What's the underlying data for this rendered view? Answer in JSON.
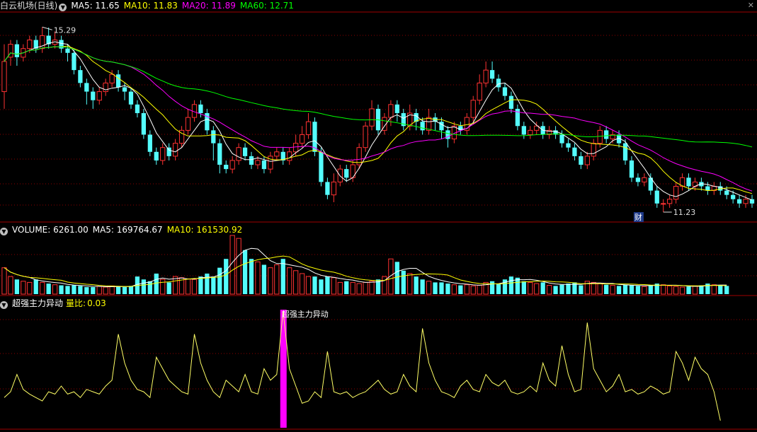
{
  "main_panel": {
    "stock_name": "白云机场(日线)",
    "ma": [
      {
        "label": "MA5: 11.65",
        "color": "#ffffff"
      },
      {
        "label": "MA10: 11.83",
        "color": "#ffff00"
      },
      {
        "label": "MA20: 11.89",
        "color": "#ff00ff"
      },
      {
        "label": "MA60: 12.71",
        "color": "#00ff00"
      }
    ],
    "high_label": "15.29",
    "low_label": "11.23",
    "badge": "财"
  },
  "volume_panel": {
    "title": "VOLUME: 6261.00",
    "ma5": "MA5: 169764.67",
    "ma10": "MA10: 161530.92"
  },
  "indicator_panel": {
    "title": "超强主力异动",
    "ratio_label": "量比:",
    "ratio_value": "0.03",
    "signal_label": "超强主力异动"
  },
  "colors": {
    "up": "#ff3232",
    "down": "#54fcfc",
    "ma5": "#ffffff",
    "ma10": "#ffff00",
    "ma20": "#ff00ff",
    "ma60": "#00ff00",
    "grid": "#8b0000",
    "indicator": "#ffff66",
    "signal": "#ff00ff"
  },
  "chart_data": {
    "type": "candlestick",
    "price_ylim": [
      11.0,
      15.6
    ],
    "high": 15.29,
    "low": 11.23,
    "candles": [
      {
        "o": 13.8,
        "c": 14.5,
        "h": 14.9,
        "l": 13.4
      },
      {
        "o": 14.6,
        "c": 14.9,
        "h": 15.0,
        "l": 14.4
      },
      {
        "o": 14.9,
        "c": 14.6,
        "h": 15.0,
        "l": 14.4
      },
      {
        "o": 14.6,
        "c": 14.8,
        "h": 14.9,
        "l": 14.5
      },
      {
        "o": 14.8,
        "c": 15.0,
        "h": 15.1,
        "l": 14.7
      },
      {
        "o": 15.0,
        "c": 14.8,
        "h": 15.1,
        "l": 14.7
      },
      {
        "o": 14.8,
        "c": 15.1,
        "h": 15.3,
        "l": 14.7
      },
      {
        "o": 15.1,
        "c": 14.9,
        "h": 15.29,
        "l": 14.8
      },
      {
        "o": 14.9,
        "c": 15.0,
        "h": 15.2,
        "l": 14.8
      },
      {
        "o": 15.0,
        "c": 14.8,
        "h": 15.1,
        "l": 14.7
      },
      {
        "o": 14.8,
        "c": 14.7,
        "h": 14.9,
        "l": 14.5
      },
      {
        "o": 14.7,
        "c": 14.3,
        "h": 14.8,
        "l": 14.2
      },
      {
        "o": 14.3,
        "c": 14.0,
        "h": 14.4,
        "l": 13.9
      },
      {
        "o": 14.0,
        "c": 13.8,
        "h": 14.1,
        "l": 13.5
      },
      {
        "o": 13.8,
        "c": 13.6,
        "h": 13.9,
        "l": 13.4
      },
      {
        "o": 13.6,
        "c": 13.8,
        "h": 13.9,
        "l": 13.5
      },
      {
        "o": 13.8,
        "c": 14.0,
        "h": 14.1,
        "l": 13.7
      },
      {
        "o": 14.0,
        "c": 14.2,
        "h": 14.3,
        "l": 13.9
      },
      {
        "o": 14.2,
        "c": 13.9,
        "h": 14.3,
        "l": 13.8
      },
      {
        "o": 13.9,
        "c": 13.8,
        "h": 14.0,
        "l": 13.6
      },
      {
        "o": 13.8,
        "c": 13.5,
        "h": 13.9,
        "l": 13.4
      },
      {
        "o": 13.5,
        "c": 13.3,
        "h": 13.6,
        "l": 13.2
      },
      {
        "o": 13.3,
        "c": 12.8,
        "h": 13.4,
        "l": 12.7
      },
      {
        "o": 12.8,
        "c": 12.4,
        "h": 12.9,
        "l": 12.3
      },
      {
        "o": 12.4,
        "c": 12.2,
        "h": 12.5,
        "l": 12.1
      },
      {
        "o": 12.2,
        "c": 12.5,
        "h": 12.6,
        "l": 12.1
      },
      {
        "o": 12.5,
        "c": 12.3,
        "h": 12.6,
        "l": 12.2
      },
      {
        "o": 12.3,
        "c": 12.6,
        "h": 12.7,
        "l": 12.2
      },
      {
        "o": 12.6,
        "c": 12.9,
        "h": 13.0,
        "l": 12.5
      },
      {
        "o": 12.9,
        "c": 13.2,
        "h": 13.4,
        "l": 12.8
      },
      {
        "o": 13.2,
        "c": 13.5,
        "h": 13.6,
        "l": 13.1
      },
      {
        "o": 13.5,
        "c": 13.3,
        "h": 13.6,
        "l": 13.2
      },
      {
        "o": 13.3,
        "c": 12.9,
        "h": 13.4,
        "l": 12.8
      },
      {
        "o": 12.9,
        "c": 12.6,
        "h": 13.0,
        "l": 12.2
      },
      {
        "o": 12.6,
        "c": 12.1,
        "h": 12.7,
        "l": 11.9
      },
      {
        "o": 12.1,
        "c": 12.0,
        "h": 12.2,
        "l": 11.9
      },
      {
        "o": 12.0,
        "c": 12.2,
        "h": 12.3,
        "l": 11.9
      },
      {
        "o": 12.2,
        "c": 12.5,
        "h": 12.6,
        "l": 12.1
      },
      {
        "o": 12.5,
        "c": 12.3,
        "h": 12.6,
        "l": 12.2
      },
      {
        "o": 12.3,
        "c": 12.1,
        "h": 12.4,
        "l": 12.0
      },
      {
        "o": 12.1,
        "c": 12.2,
        "h": 12.3,
        "l": 12.0
      },
      {
        "o": 12.2,
        "c": 12.0,
        "h": 12.3,
        "l": 11.9
      },
      {
        "o": 12.0,
        "c": 12.3,
        "h": 12.4,
        "l": 11.9
      },
      {
        "o": 12.3,
        "c": 12.4,
        "h": 12.5,
        "l": 12.2
      },
      {
        "o": 12.4,
        "c": 12.2,
        "h": 12.5,
        "l": 12.1
      },
      {
        "o": 12.2,
        "c": 12.4,
        "h": 12.5,
        "l": 12.1
      },
      {
        "o": 12.4,
        "c": 12.6,
        "h": 12.8,
        "l": 12.3
      },
      {
        "o": 12.6,
        "c": 12.8,
        "h": 13.0,
        "l": 12.5
      },
      {
        "o": 12.8,
        "c": 13.1,
        "h": 13.3,
        "l": 12.7
      },
      {
        "o": 13.1,
        "c": 12.4,
        "h": 13.2,
        "l": 12.3
      },
      {
        "o": 12.4,
        "c": 11.7,
        "h": 12.5,
        "l": 11.6
      },
      {
        "o": 11.7,
        "c": 11.4,
        "h": 11.8,
        "l": 11.3
      },
      {
        "o": 11.4,
        "c": 11.7,
        "h": 11.9,
        "l": 11.23
      },
      {
        "o": 11.7,
        "c": 12.0,
        "h": 12.1,
        "l": 11.6
      },
      {
        "o": 12.0,
        "c": 11.8,
        "h": 12.1,
        "l": 11.7
      },
      {
        "o": 11.8,
        "c": 12.1,
        "h": 12.2,
        "l": 11.7
      },
      {
        "o": 12.1,
        "c": 12.5,
        "h": 12.6,
        "l": 12.0
      },
      {
        "o": 12.5,
        "c": 13.0,
        "h": 13.1,
        "l": 12.4
      },
      {
        "o": 13.0,
        "c": 13.4,
        "h": 13.6,
        "l": 12.9
      },
      {
        "o": 13.4,
        "c": 12.9,
        "h": 13.5,
        "l": 12.8
      },
      {
        "o": 12.9,
        "c": 13.2,
        "h": 13.3,
        "l": 12.8
      },
      {
        "o": 13.2,
        "c": 13.5,
        "h": 13.6,
        "l": 13.0
      },
      {
        "o": 13.5,
        "c": 13.3,
        "h": 13.6,
        "l": 13.1
      },
      {
        "o": 13.3,
        "c": 13.0,
        "h": 13.4,
        "l": 12.9
      },
      {
        "o": 13.0,
        "c": 13.3,
        "h": 13.5,
        "l": 12.9
      },
      {
        "o": 13.3,
        "c": 13.1,
        "h": 13.4,
        "l": 12.9
      },
      {
        "o": 13.1,
        "c": 12.9,
        "h": 13.2,
        "l": 12.8
      },
      {
        "o": 12.9,
        "c": 13.2,
        "h": 13.4,
        "l": 12.8
      },
      {
        "o": 13.2,
        "c": 13.1,
        "h": 13.3,
        "l": 12.9
      },
      {
        "o": 13.1,
        "c": 12.9,
        "h": 13.2,
        "l": 12.7
      },
      {
        "o": 12.9,
        "c": 12.7,
        "h": 13.0,
        "l": 12.5
      },
      {
        "o": 12.7,
        "c": 13.0,
        "h": 13.1,
        "l": 12.6
      },
      {
        "o": 13.0,
        "c": 12.9,
        "h": 13.1,
        "l": 12.8
      },
      {
        "o": 12.9,
        "c": 13.2,
        "h": 13.3,
        "l": 12.8
      },
      {
        "o": 13.2,
        "c": 13.6,
        "h": 13.7,
        "l": 13.1
      },
      {
        "o": 13.6,
        "c": 14.0,
        "h": 14.2,
        "l": 13.5
      },
      {
        "o": 14.0,
        "c": 14.3,
        "h": 14.5,
        "l": 13.9
      },
      {
        "o": 14.3,
        "c": 14.1,
        "h": 14.5,
        "l": 14.0
      },
      {
        "o": 14.1,
        "c": 13.9,
        "h": 14.2,
        "l": 13.8
      },
      {
        "o": 13.9,
        "c": 13.7,
        "h": 14.0,
        "l": 13.6
      },
      {
        "o": 13.7,
        "c": 13.4,
        "h": 13.8,
        "l": 13.3
      },
      {
        "o": 13.4,
        "c": 13.0,
        "h": 13.5,
        "l": 12.9
      },
      {
        "o": 13.0,
        "c": 12.8,
        "h": 13.1,
        "l": 12.7
      },
      {
        "o": 12.8,
        "c": 12.9,
        "h": 13.0,
        "l": 12.7
      },
      {
        "o": 12.9,
        "c": 13.0,
        "h": 13.1,
        "l": 12.8
      },
      {
        "o": 13.0,
        "c": 12.8,
        "h": 13.1,
        "l": 12.7
      },
      {
        "o": 12.8,
        "c": 12.9,
        "h": 13.0,
        "l": 12.7
      },
      {
        "o": 12.9,
        "c": 12.8,
        "h": 13.0,
        "l": 12.7
      },
      {
        "o": 12.8,
        "c": 12.6,
        "h": 12.9,
        "l": 12.5
      },
      {
        "o": 12.6,
        "c": 12.5,
        "h": 12.7,
        "l": 12.4
      },
      {
        "o": 12.5,
        "c": 12.3,
        "h": 12.6,
        "l": 12.2
      },
      {
        "o": 12.3,
        "c": 12.1,
        "h": 12.4,
        "l": 12.0
      },
      {
        "o": 12.1,
        "c": 12.3,
        "h": 12.4,
        "l": 12.0
      },
      {
        "o": 12.3,
        "c": 12.6,
        "h": 12.7,
        "l": 12.2
      },
      {
        "o": 12.6,
        "c": 12.9,
        "h": 13.0,
        "l": 12.5
      },
      {
        "o": 12.9,
        "c": 12.7,
        "h": 13.0,
        "l": 12.6
      },
      {
        "o": 12.7,
        "c": 12.8,
        "h": 12.9,
        "l": 12.6
      },
      {
        "o": 12.8,
        "c": 12.6,
        "h": 12.9,
        "l": 12.5
      },
      {
        "o": 12.6,
        "c": 12.2,
        "h": 12.7,
        "l": 12.1
      },
      {
        "o": 12.2,
        "c": 11.8,
        "h": 12.3,
        "l": 11.7
      },
      {
        "o": 11.8,
        "c": 11.7,
        "h": 11.9,
        "l": 11.6
      },
      {
        "o": 11.7,
        "c": 11.8,
        "h": 11.9,
        "l": 11.6
      },
      {
        "o": 11.8,
        "c": 11.5,
        "h": 11.9,
        "l": 11.4
      },
      {
        "o": 11.5,
        "c": 11.2,
        "h": 11.6,
        "l": 11.1
      },
      {
        "o": 11.2,
        "c": 11.2,
        "h": 11.3,
        "l": 11.0
      },
      {
        "o": 11.2,
        "c": 11.3,
        "h": 11.4,
        "l": 11.1
      },
      {
        "o": 11.3,
        "c": 11.6,
        "h": 11.7,
        "l": 11.2
      },
      {
        "o": 11.6,
        "c": 11.8,
        "h": 11.9,
        "l": 11.5
      },
      {
        "o": 11.8,
        "c": 11.6,
        "h": 11.9,
        "l": 11.5
      },
      {
        "o": 11.6,
        "c": 11.7,
        "h": 11.8,
        "l": 11.5
      },
      {
        "o": 11.7,
        "c": 11.6,
        "h": 11.8,
        "l": 11.5
      },
      {
        "o": 11.6,
        "c": 11.5,
        "h": 11.7,
        "l": 11.4
      },
      {
        "o": 11.5,
        "c": 11.6,
        "h": 11.7,
        "l": 11.4
      },
      {
        "o": 11.6,
        "c": 11.5,
        "h": 11.7,
        "l": 11.4
      },
      {
        "o": 11.5,
        "c": 11.4,
        "h": 11.6,
        "l": 11.3
      },
      {
        "o": 11.4,
        "c": 11.3,
        "h": 11.5,
        "l": 11.2
      },
      {
        "o": 11.3,
        "c": 11.2,
        "h": 11.4,
        "l": 11.1
      },
      {
        "o": 11.2,
        "c": 11.3,
        "h": 11.4,
        "l": 11.1
      },
      {
        "o": 11.3,
        "c": 11.2,
        "h": 11.4,
        "l": 11.1
      }
    ],
    "volume": [
      0.45,
      0.3,
      0.25,
      0.22,
      0.2,
      0.25,
      0.2,
      0.18,
      0.16,
      0.15,
      0.14,
      0.15,
      0.14,
      0.12,
      0.12,
      0.13,
      0.12,
      0.14,
      0.13,
      0.12,
      0.14,
      0.3,
      0.25,
      0.22,
      0.35,
      0.25,
      0.2,
      0.3,
      0.28,
      0.26,
      0.25,
      0.3,
      0.35,
      0.3,
      0.45,
      0.6,
      1.0,
      0.95,
      0.75,
      0.6,
      0.55,
      0.5,
      0.45,
      0.5,
      0.6,
      0.45,
      0.4,
      0.35,
      0.3,
      0.3,
      0.25,
      0.3,
      0.28,
      0.2,
      0.22,
      0.2,
      0.18,
      0.2,
      0.22,
      0.25,
      0.3,
      0.6,
      0.55,
      0.4,
      0.35,
      0.3,
      0.25,
      0.22,
      0.2,
      0.2,
      0.18,
      0.16,
      0.15,
      0.16,
      0.14,
      0.15,
      0.2,
      0.22,
      0.18,
      0.25,
      0.3,
      0.28,
      0.22,
      0.2,
      0.18,
      0.2,
      0.15,
      0.14,
      0.16,
      0.18,
      0.2,
      0.15,
      0.22,
      0.2,
      0.18,
      0.16,
      0.15,
      0.14,
      0.16,
      0.15,
      0.14,
      0.13,
      0.15,
      0.18,
      0.16,
      0.14,
      0.13,
      0.12,
      0.13,
      0.14,
      0.15,
      0.18,
      0.16,
      0.15,
      0.14
    ],
    "indicator": [
      0.25,
      0.3,
      0.45,
      0.32,
      0.28,
      0.25,
      0.22,
      0.3,
      0.28,
      0.35,
      0.28,
      0.3,
      0.25,
      0.32,
      0.3,
      0.28,
      0.35,
      0.4,
      0.8,
      0.55,
      0.4,
      0.32,
      0.3,
      0.25,
      0.6,
      0.5,
      0.4,
      0.35,
      0.3,
      0.28,
      0.8,
      0.55,
      0.4,
      0.3,
      0.25,
      0.4,
      0.35,
      0.3,
      0.45,
      0.3,
      0.28,
      0.5,
      0.4,
      0.45,
      1.0,
      0.5,
      0.35,
      0.2,
      0.22,
      0.3,
      0.25,
      0.65,
      0.3,
      0.28,
      0.3,
      0.25,
      0.28,
      0.3,
      0.35,
      0.4,
      0.32,
      0.28,
      0.3,
      0.45,
      0.35,
      0.3,
      0.85,
      0.55,
      0.4,
      0.3,
      0.28,
      0.25,
      0.35,
      0.4,
      0.32,
      0.3,
      0.45,
      0.38,
      0.35,
      0.4,
      0.3,
      0.28,
      0.3,
      0.35,
      0.3,
      0.55,
      0.4,
      0.35,
      0.7,
      0.45,
      0.3,
      0.32,
      0.9,
      0.5,
      0.4,
      0.3,
      0.35,
      0.45,
      0.3,
      0.32,
      0.28,
      0.3,
      0.35,
      0.32,
      0.28,
      0.3,
      0.65,
      0.55,
      0.4,
      0.6,
      0.5,
      0.45,
      0.3,
      0.05
    ]
  }
}
